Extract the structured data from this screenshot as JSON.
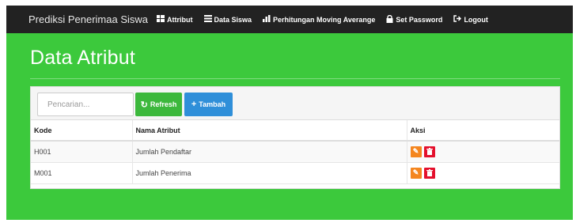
{
  "navbar": {
    "brand": "Prediksi Penerimaa Siswa",
    "items": [
      {
        "label": "Attribut",
        "icon": "table-icon"
      },
      {
        "label": "Data Siswa",
        "icon": "list-icon"
      },
      {
        "label": "Perhitungan Moving Averange",
        "icon": "bar-chart-icon"
      },
      {
        "label": "Set Password",
        "icon": "lock-icon"
      },
      {
        "label": "Logout",
        "icon": "logout-icon"
      }
    ]
  },
  "page": {
    "title": "Data Atribut"
  },
  "toolbar": {
    "search_placeholder": "Pencarian...",
    "refresh_label": "Refresh",
    "add_label": "Tambah"
  },
  "table": {
    "headers": [
      "Kode",
      "Nama Atribut",
      "Aksi"
    ],
    "rows": [
      {
        "kode": "H001",
        "nama": "Jumlah Pendaftar"
      },
      {
        "kode": "M001",
        "nama": "Jumlah Penerima"
      }
    ]
  },
  "colors": {
    "background": "#3cc93c",
    "navbar": "#222222",
    "refresh": "#3cb83c",
    "add": "#2f8fd9",
    "edit": "#f4861f",
    "delete": "#e4102c"
  }
}
